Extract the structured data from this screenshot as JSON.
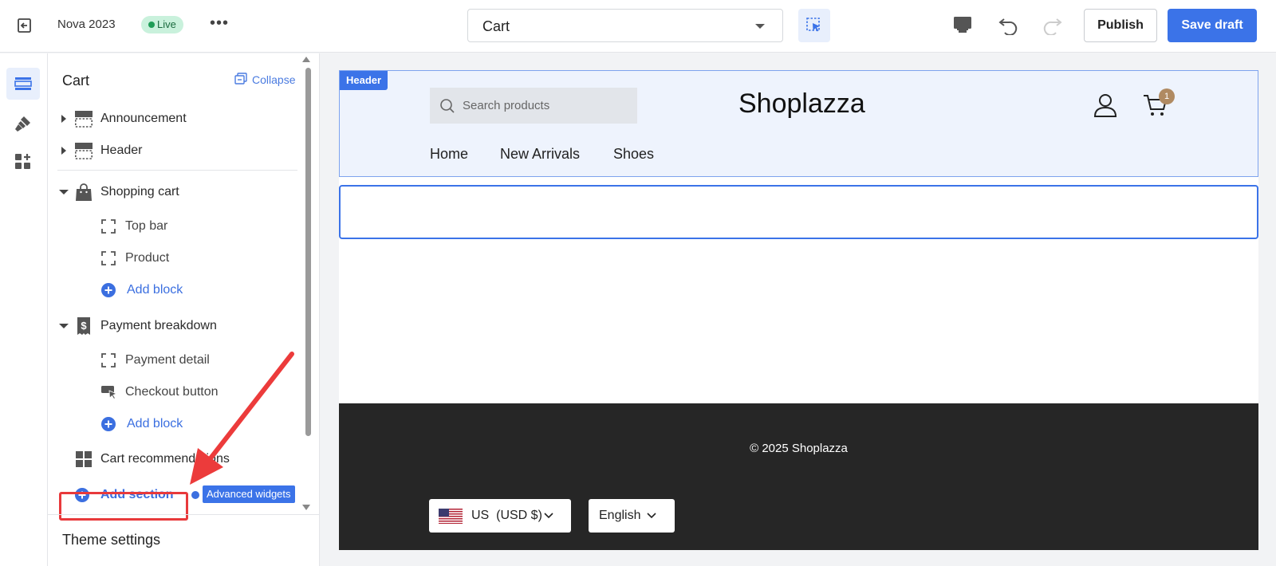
{
  "topbar": {
    "theme_name": "Nova 2023",
    "status_badge": "Live",
    "more_label": "•••",
    "page_select_value": "Cart",
    "publish_label": "Publish",
    "save_label": "Save draft"
  },
  "sidebar": {
    "title": "Cart",
    "collapse_label": "Collapse",
    "sections": [
      {
        "label": "Announcement",
        "icon": "section-layout-icon",
        "expanded": false
      },
      {
        "label": "Header",
        "icon": "section-layout-icon",
        "expanded": false
      },
      {
        "label": "Shopping cart",
        "icon": "shopping-bag-icon",
        "expanded": true,
        "blocks": [
          "Top bar",
          "Product"
        ],
        "add_block": "Add block"
      },
      {
        "label": "Payment breakdown",
        "icon": "receipt-icon",
        "expanded": true,
        "blocks": [
          "Payment detail",
          "Checkout button"
        ],
        "add_block": "Add block"
      },
      {
        "label": "Cart recommendations",
        "icon": "grid-icon",
        "expanded": false
      }
    ],
    "add_section_label": "Add section",
    "advanced_widgets_label": "Advanced widgets",
    "theme_settings_label": "Theme settings"
  },
  "preview": {
    "header_tag": "Header",
    "search_placeholder": "Search products",
    "logo": "Shoplazza",
    "cart_count": "1",
    "nav": [
      "Home",
      "New Arrivals",
      "Shoes"
    ],
    "copyright": "© 2025 Shoplazza",
    "currency": "US  (USD $)",
    "language": "English"
  },
  "colors": {
    "accent": "#3b73e8",
    "highlight_red": "#e8393b",
    "footer_bg": "#262626",
    "live_badge_bg": "#c9f1dc"
  }
}
